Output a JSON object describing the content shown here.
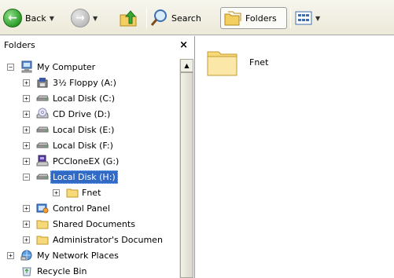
{
  "toolbar": {
    "back_label": "Back",
    "search_label": "Search",
    "folders_label": "Folders"
  },
  "folders_pane": {
    "title": "Folders",
    "close_glyph": "×"
  },
  "tree": [
    {
      "label": "My Computer",
      "icon": "computer-icon",
      "expander": "−",
      "level": 1
    },
    {
      "label": "3½ Floppy (A:)",
      "icon": "floppy-icon",
      "expander": "+",
      "level": 2
    },
    {
      "label": "Local Disk (C:)",
      "icon": "hard-disk-icon",
      "expander": "+",
      "level": 2
    },
    {
      "label": "CD Drive (D:)",
      "icon": "cd-drive-icon",
      "expander": "+",
      "level": 2
    },
    {
      "label": "Local Disk (E:)",
      "icon": "hard-disk-icon",
      "expander": "+",
      "level": 2
    },
    {
      "label": "Local Disk (F:)",
      "icon": "hard-disk-icon",
      "expander": "+",
      "level": 2
    },
    {
      "label": "PCCloneEX (G:)",
      "icon": "pcclone-drive-icon",
      "expander": "+",
      "level": 2
    },
    {
      "label": "Local Disk (H:)",
      "icon": "hard-disk-icon",
      "expander": "−",
      "level": 2,
      "selected": true
    },
    {
      "label": "Fnet",
      "icon": "folder-icon",
      "expander": "+",
      "level": 3
    },
    {
      "label": "Control Panel",
      "icon": "control-panel-icon",
      "expander": "+",
      "level": 2
    },
    {
      "label": "Shared Documents",
      "icon": "folder-icon",
      "expander": "+",
      "level": 2
    },
    {
      "label": "Administrator's Documen",
      "icon": "folder-icon",
      "expander": "+",
      "level": 2
    },
    {
      "label": "My Network Places",
      "icon": "network-places-icon",
      "expander": "+",
      "level": 1
    },
    {
      "label": "Recycle Bin",
      "icon": "recycle-bin-icon",
      "expander": "",
      "level": 1
    }
  ],
  "content": {
    "items": [
      {
        "label": "Fnet",
        "icon": "folder-icon"
      }
    ]
  },
  "colors": {
    "selection": "#316ac5",
    "folder_yellow": "#f6d978",
    "toolbar_bg": "#ece9d8"
  }
}
